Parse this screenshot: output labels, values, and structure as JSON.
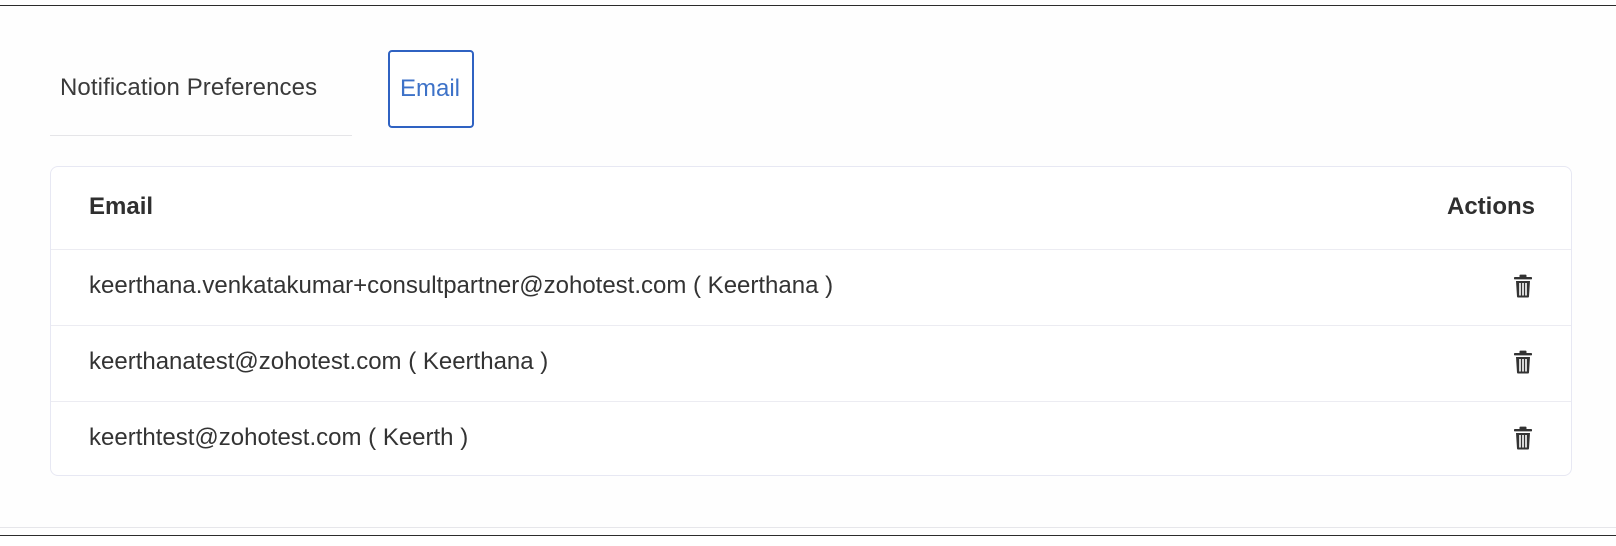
{
  "tabs": {
    "notification_preferences": "Notification Preferences",
    "email": "Email"
  },
  "table": {
    "columns": {
      "email": "Email",
      "actions": "Actions"
    },
    "rows": [
      {
        "email": "keerthana.venkatakumar+consultpartner@zohotest.com ( Keerthana )",
        "action_icon": "trash-icon"
      },
      {
        "email": "keerthanatest@zohotest.com ( Keerthana )",
        "action_icon": "trash-icon"
      },
      {
        "email": "keerthtest@zohotest.com ( Keerth )",
        "action_icon": "trash-icon"
      }
    ]
  },
  "colors": {
    "accent": "#2f62c2",
    "accent_text": "#3d72c8",
    "border": "#e7e8f3",
    "text": "#333333"
  }
}
